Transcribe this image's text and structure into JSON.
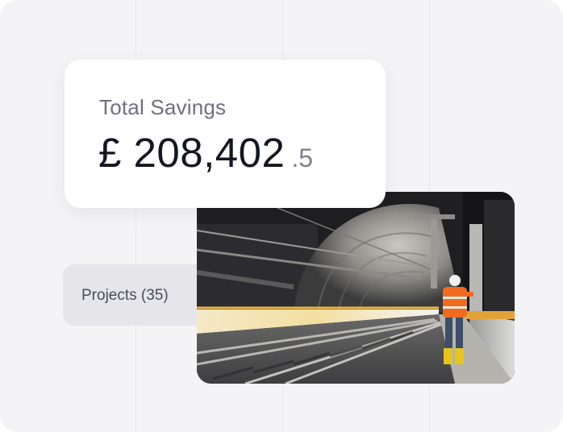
{
  "savings": {
    "label": "Total Savings",
    "amount": "£ 208,402",
    "decimal": ".5"
  },
  "projects": {
    "label": "Projects (35)"
  },
  "photo": {
    "subject": "rail-tunnel-worker-photo"
  },
  "colors": {
    "background": "#f4f4f6",
    "card": "#ffffff",
    "pill": "#e6e6ea",
    "text_primary": "#15161f",
    "text_secondary": "#6f6f80",
    "hi_vis_orange": "#f26a1f"
  }
}
